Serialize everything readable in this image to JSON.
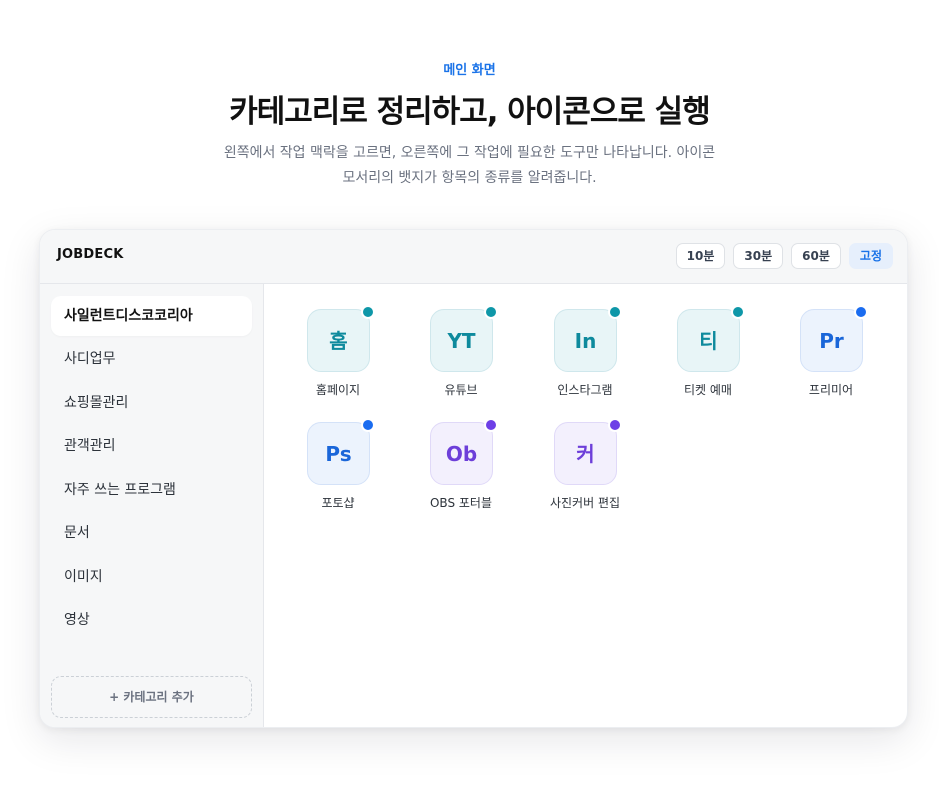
{
  "hero": {
    "eyebrow": "메인 화면",
    "title": "카테고리로 정리하고, 아이콘으로 실행",
    "description_line1": "왼쪽에서 작업 맥락을 고르면, 오른쪽에 그 작업에 필요한 도구만 나타납니다. 아이콘",
    "description_line2": "모서리의 뱃지가 항목의 종류를 알려줍니다."
  },
  "app": {
    "brand": "JOBDECK",
    "timers": [
      "10분",
      "30분",
      "60분",
      "고정"
    ],
    "active_timer": "고정",
    "categories": [
      "사일런트디스코코리아",
      "사디업무",
      "쇼핑몰관리",
      "관객관리",
      "자주 쓰는 프로그램",
      "문서",
      "이미지",
      "영상"
    ],
    "active_category": "사일런트디스코코리아",
    "add_category_label": "+ 카테고리 추가",
    "tools": [
      {
        "glyph": "홈",
        "label": "홈페이지",
        "badge_color": "#0e97a8"
      },
      {
        "glyph": "YT",
        "label": "유튜브",
        "badge_color": "#0e97a8"
      },
      {
        "glyph": "In",
        "label": "인스타그램",
        "badge_color": "#0e97a8"
      },
      {
        "glyph": "티",
        "label": "티켓 예매",
        "badge_color": "#0e97a8"
      },
      {
        "glyph": "Pr",
        "label": "프리미어",
        "badge_color": "#1a6cf0"
      },
      {
        "glyph": "Ps",
        "label": "포토샵",
        "badge_color": "#1a6cf0"
      },
      {
        "glyph": "Ob",
        "label": "OBS 포터블",
        "badge_color": "#6d3fe6"
      },
      {
        "glyph": "커",
        "label": "사진커버 편집",
        "badge_color": "#6d3fe6"
      }
    ]
  }
}
